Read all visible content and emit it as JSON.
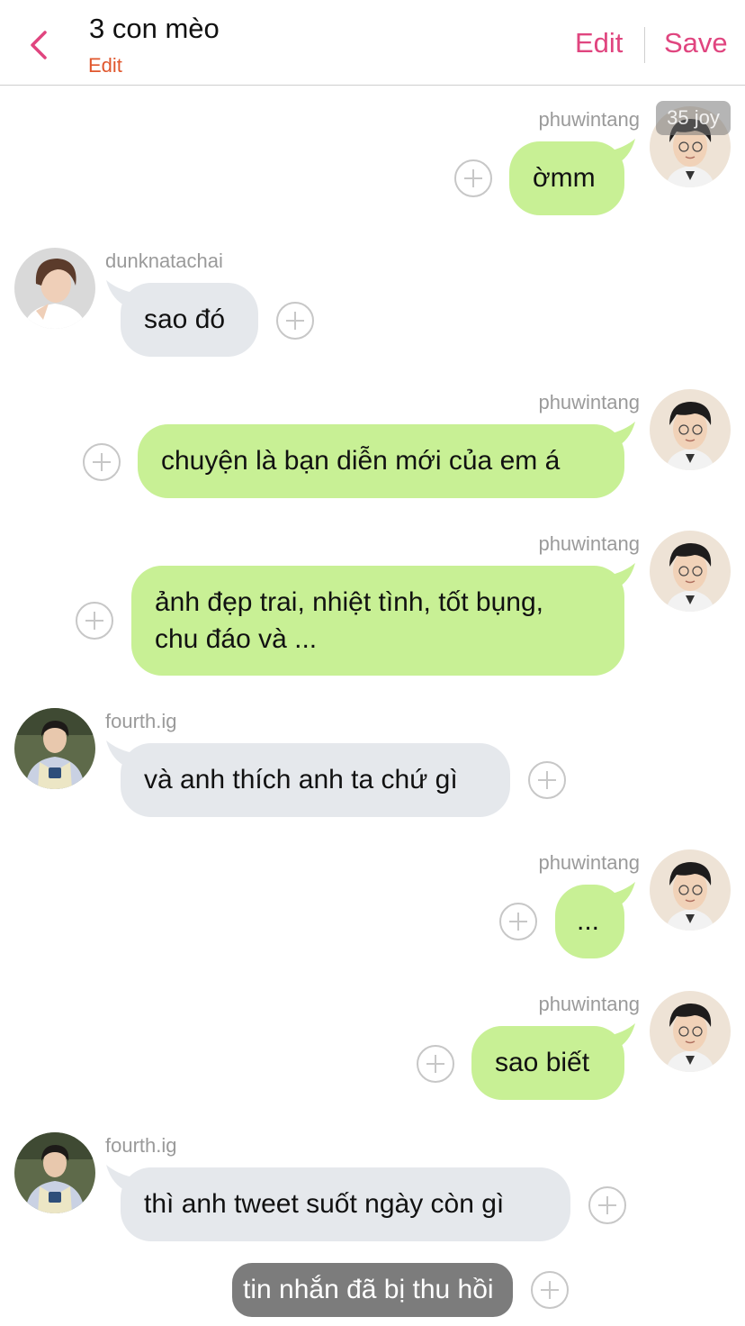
{
  "header": {
    "title": "3 con mèo",
    "subtitle": "Edit",
    "edit_label": "Edit",
    "save_label": "Save",
    "accent_color": "#e0457f"
  },
  "badge": "35 joy",
  "messages": [
    {
      "sender": "phuwintang",
      "side": "right",
      "text": "ờmm"
    },
    {
      "sender": "dunknatachai",
      "side": "left",
      "text": "sao đó"
    },
    {
      "sender": "phuwintang",
      "side": "right",
      "text": "chuyện là bạn diễn mới của em á"
    },
    {
      "sender": "phuwintang",
      "side": "right",
      "text_line1": "ảnh đẹp trai, nhiệt tình, tốt bụng,",
      "text_line2": "chu đáo và ..."
    },
    {
      "sender": "fourth.ig",
      "side": "left",
      "text": "và anh thích anh ta chứ gì"
    },
    {
      "sender": "phuwintang",
      "side": "right",
      "text": "..."
    },
    {
      "sender": "phuwintang",
      "side": "right",
      "text": "sao biết"
    },
    {
      "sender": "fourth.ig",
      "side": "left",
      "text": "thì anh tweet suốt ngày còn gì"
    }
  ],
  "recalled_text": "tin nhắn đã bị thu hồi",
  "colors": {
    "right_bubble": "#c8f095",
    "left_bubble": "#e5e8ec",
    "recalled_bubble": "#7c7c7c"
  }
}
